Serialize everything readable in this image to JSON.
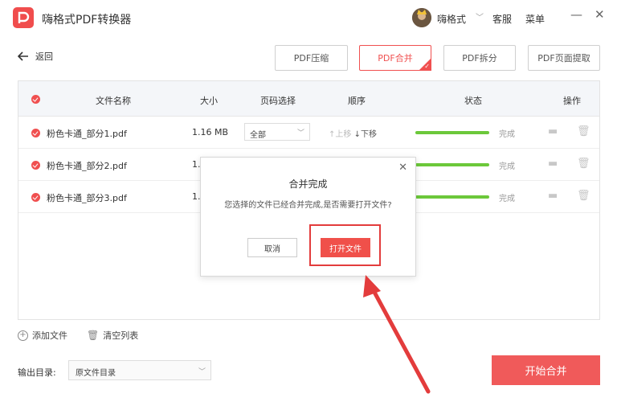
{
  "app": {
    "title": "嗨格式PDF转换器",
    "username": "嗨格式",
    "service_label": "客服",
    "menu_label": "菜单"
  },
  "window": {
    "minimize": "—",
    "close": "✕"
  },
  "nav": {
    "back_label": "返回"
  },
  "tabs": [
    {
      "label": "PDF压缩",
      "active": false
    },
    {
      "label": "PDF合并",
      "active": true
    },
    {
      "label": "PDF拆分",
      "active": false
    },
    {
      "label": "PDF页面提取",
      "active": false
    }
  ],
  "table": {
    "headers": {
      "name": "文件名称",
      "size": "大小",
      "page_select": "页码选择",
      "order": "顺序",
      "status": "状态",
      "action": "操作"
    },
    "rows": [
      {
        "name": "粉色卡通_部分1.pdf",
        "size": "1.16 MB",
        "page": "全部",
        "up": "↑上移",
        "down": "↓下移",
        "status": "完成",
        "progress": 1.0
      },
      {
        "name": "粉色卡通_部分2.pdf",
        "size": "1.",
        "page": "",
        "up": "",
        "down": "",
        "status": "完成",
        "progress": 1.0
      },
      {
        "name": "粉色卡通_部分3.pdf",
        "size": "1.",
        "page": "",
        "up": "",
        "down": "",
        "status": "完成",
        "progress": 1.0
      }
    ]
  },
  "footer": {
    "add_file": "添加文件",
    "clear_list": "清空列表",
    "output_label": "输出目录:",
    "output_value": "原文件目录",
    "start_button": "开始合并"
  },
  "dialog": {
    "title": "合并完成",
    "message": "您选择的文件已经合并完成,是否需要打开文件?",
    "cancel": "取消",
    "open": "打开文件",
    "close": "✕"
  },
  "colors": {
    "accent": "#f05050",
    "progress": "#6cc83a"
  }
}
